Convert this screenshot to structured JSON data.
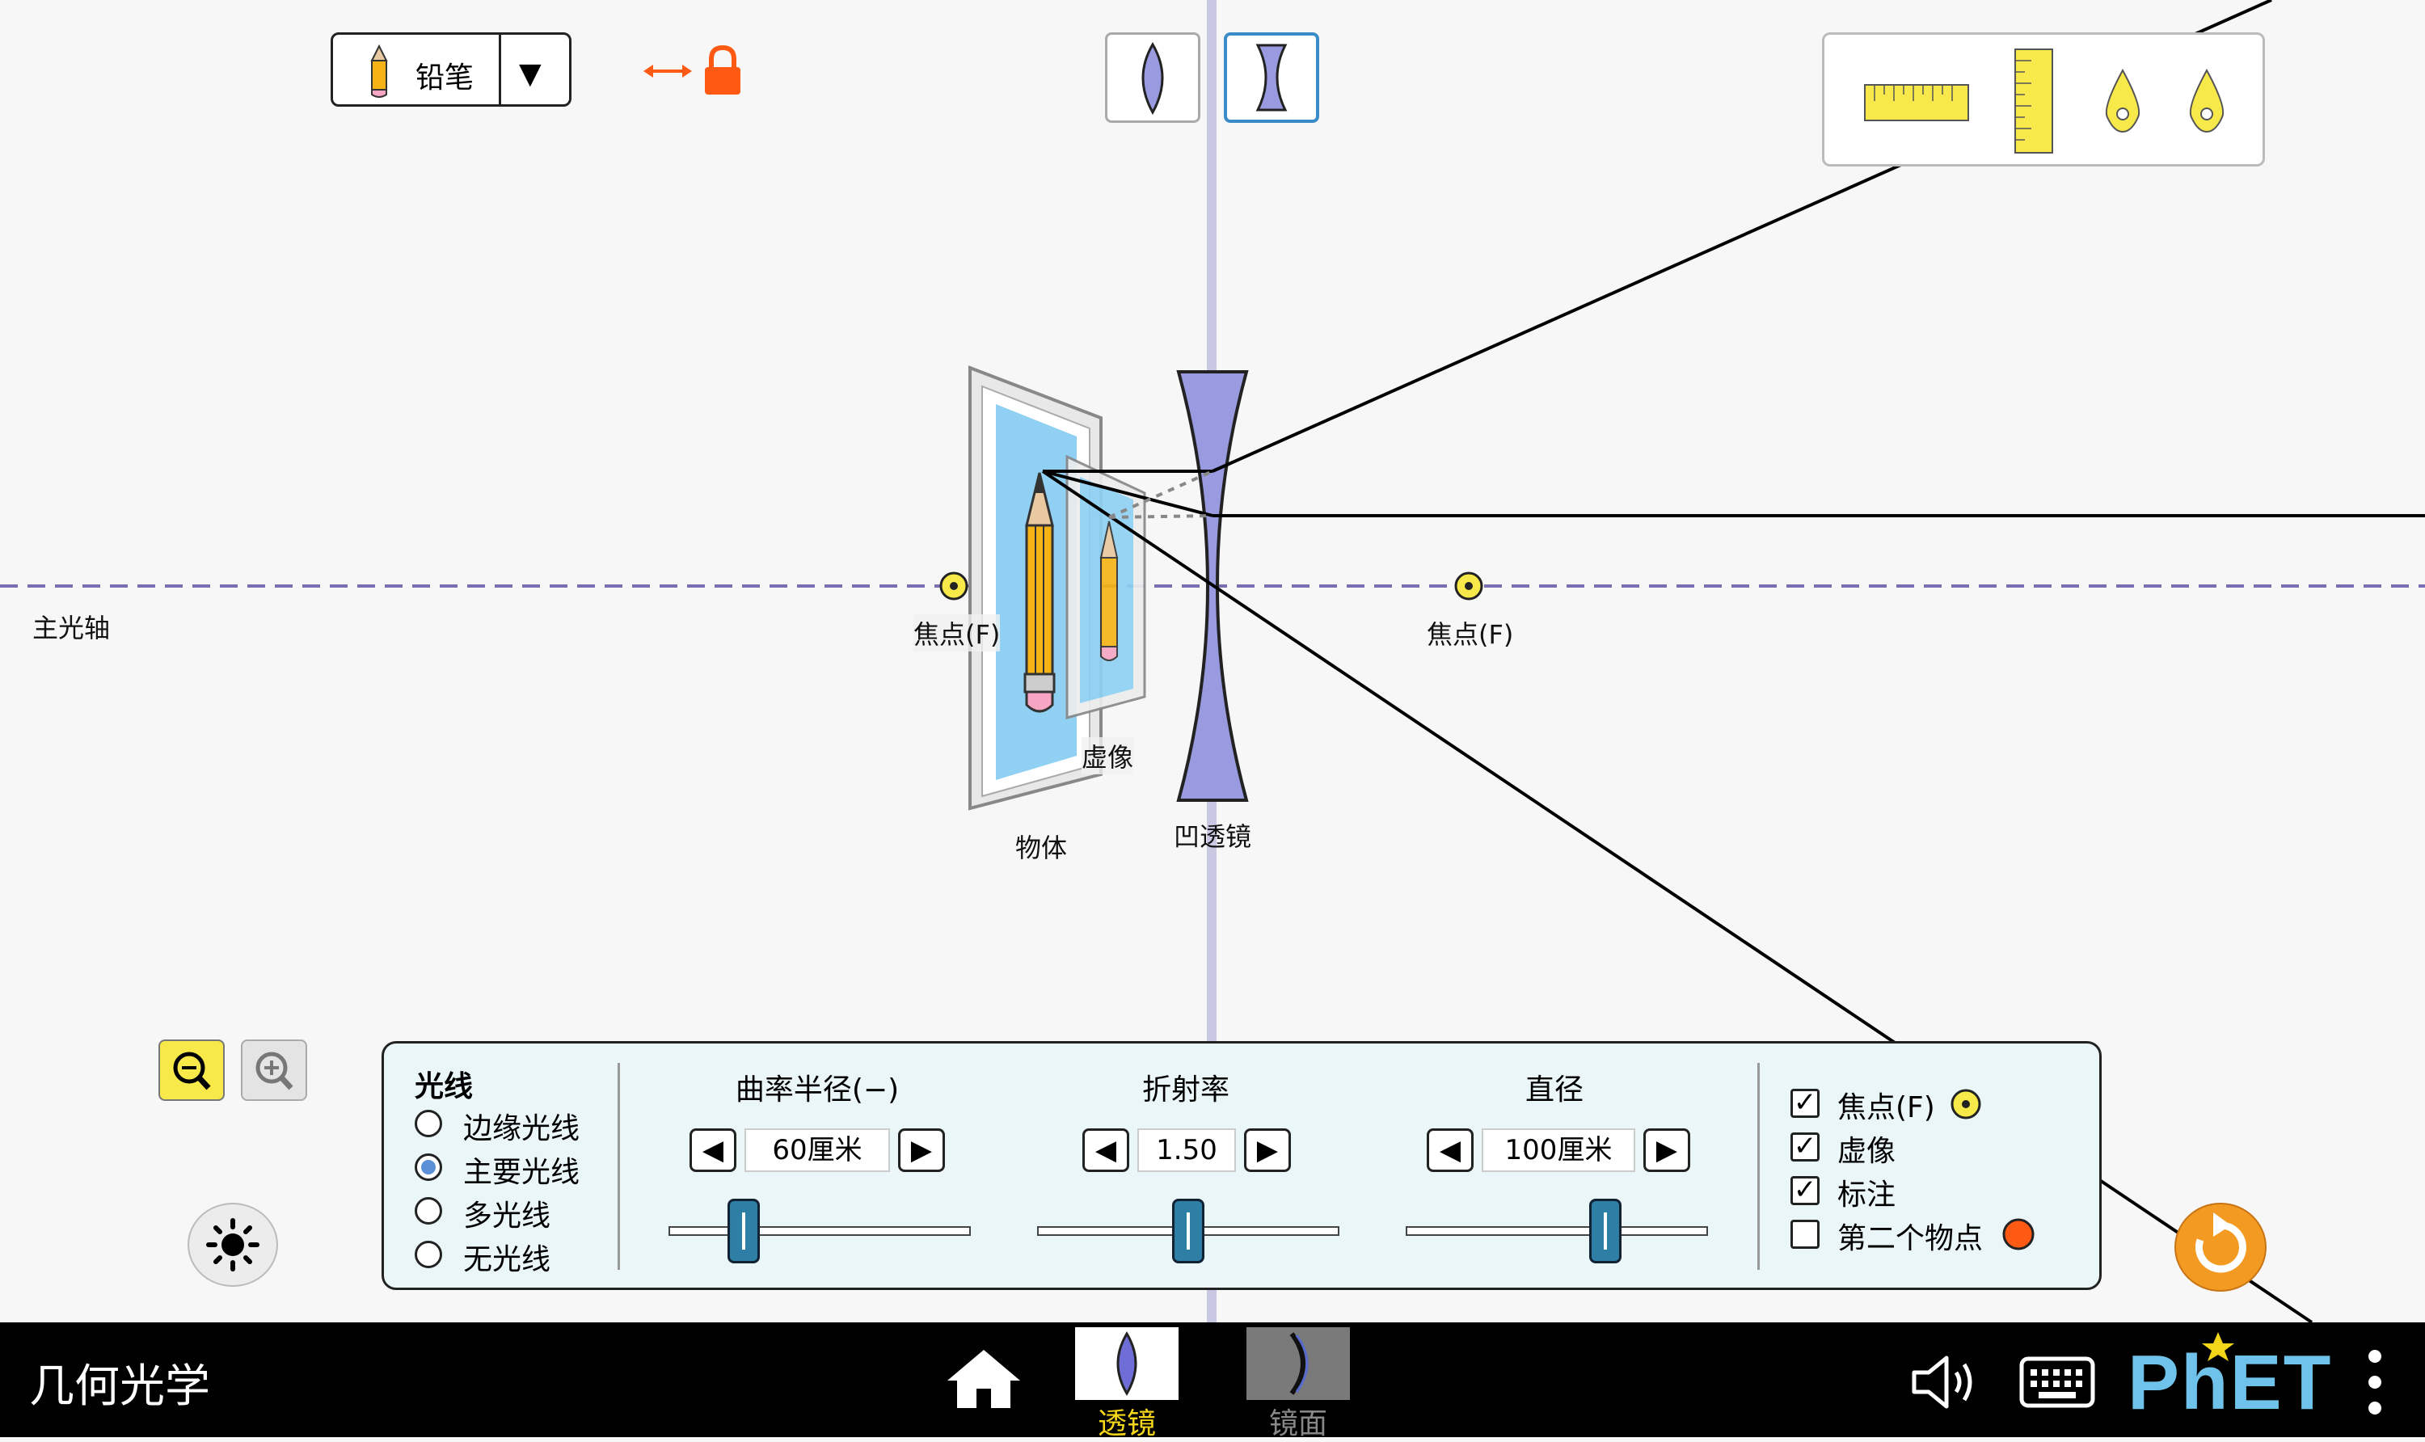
{
  "object_selector": {
    "label": "铅笔"
  },
  "scene_labels": {
    "optical_axis": "主光轴",
    "focal_left": "焦点(F)",
    "focal_right": "焦点(F)",
    "virtual_image": "虚像",
    "object": "物体",
    "lens": "凹透镜"
  },
  "panel": {
    "rays_title": "光线",
    "ray_options": [
      "边缘光线",
      "主要光线",
      "多光线",
      "无光线"
    ],
    "ray_selected": "主要光线",
    "sliders": [
      {
        "title": "曲率半径(−)",
        "value": "60厘米",
        "level": 0.25
      },
      {
        "title": "折射率",
        "value": "1.50",
        "level": 0.5
      },
      {
        "title": "直径",
        "value": "100厘米",
        "level": 0.67
      }
    ],
    "checkboxes": [
      {
        "label": "焦点(F)",
        "checked": true
      },
      {
        "label": "虚像",
        "checked": true
      },
      {
        "label": "标注",
        "checked": true
      },
      {
        "label": "第二个物点",
        "checked": false
      }
    ]
  },
  "navbar": {
    "app_title": "几何光学",
    "screens": [
      {
        "label": "透镜",
        "selected": true
      },
      {
        "label": "镜面",
        "selected": false
      }
    ],
    "brand": "PhET"
  },
  "colors": {
    "accent_yellow": "#f7e94a",
    "lens_fill": "#9a9ae0",
    "lock_orange": "#ff5a14",
    "reset_orange": "#f39a22",
    "panel_bg": "#eaf6f8",
    "selected_screen": "#f3d61a"
  }
}
